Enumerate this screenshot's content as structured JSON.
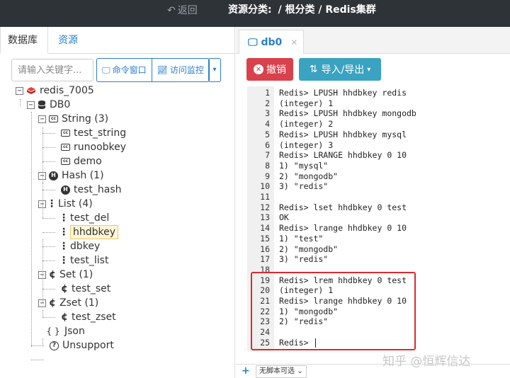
{
  "topbar": {
    "back_label": "返回",
    "crumb_prefix": "资源分类:",
    "crumb_path": "/ 根分类 / Redis集群"
  },
  "left_tabs": [
    "数据库",
    "资源"
  ],
  "search": {
    "placeholder": "请输入关键字..."
  },
  "toolbar": {
    "command_window": "命令窗口",
    "access_monitor": "访问监控"
  },
  "tree": {
    "root": "redis_7005",
    "db": "DB0",
    "string_group": "String (3)",
    "string_items": [
      "test_string",
      "runoobkey",
      "demo"
    ],
    "hash_group": "Hash (1)",
    "hash_items": [
      "test_hash"
    ],
    "list_group": "List (4)",
    "list_items": [
      "test_del",
      "hhdbkey",
      "dbkey",
      "test_list"
    ],
    "set_group": "Set (1)",
    "set_items": [
      "test_set"
    ],
    "zset_group": "Zset (1)",
    "zset_items": [
      "test_zset"
    ],
    "json": "Json",
    "unsupport": "Unsupport",
    "selected": "hhdbkey"
  },
  "editor_tab": {
    "label": "db0"
  },
  "buttons": {
    "undo": "撤销",
    "import_export": "导入/导出"
  },
  "editor_lines": [
    "Redis> LPUSH hhdbkey redis",
    "(integer) 1",
    "Redis> LPUSH hhdbkey mongodb",
    "(integer) 2",
    "Redis> LPUSH hhdbkey mysql",
    "(integer) 3",
    "Redis> LRANGE hhdbkey 0 10",
    "1) \"mysql\"",
    "2) \"mongodb\"",
    "3) \"redis\"",
    "",
    "Redis> lset hhdbkey 0 test",
    "OK",
    "Redis> lrange hhdbkey 0 10",
    "1) \"test\"",
    "2) \"mongodb\"",
    "3) \"redis\"",
    "",
    "Redis> lrem hhdbkey 0 test",
    "(integer) 1",
    "Redis> lrange hhdbkey 0 10",
    "1) \"mongodb\"",
    "2) \"redis\"",
    "",
    "Redis> "
  ],
  "bottom": {
    "script_select": "无脚本可选"
  },
  "watermark": "知乎 @恒辉信达",
  "colors": {
    "accent": "#2a7fc9",
    "undo": "#d9414c",
    "import": "#3aa3c1",
    "highlight": "#e0292c",
    "topbar": "#2e3338"
  }
}
